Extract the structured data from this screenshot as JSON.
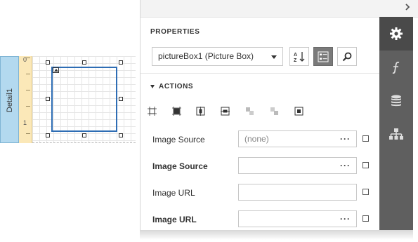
{
  "designer": {
    "band_label": "Detail1",
    "ruler_numbers": [
      "0",
      "1"
    ]
  },
  "panel": {
    "title": "PROPERTIES",
    "component_combo": "pictureBox1 (Picture Box)",
    "section_title": "ACTIONS",
    "rows": [
      {
        "label": "Image Source",
        "bold": false,
        "value": "(none)",
        "has_dots": true
      },
      {
        "label": "Image Source",
        "bold": true,
        "value": "",
        "has_dots": true
      },
      {
        "label": "Image URL",
        "bold": false,
        "value": "",
        "has_dots": false
      },
      {
        "label": "Image URL",
        "bold": true,
        "value": "",
        "has_dots": true
      }
    ],
    "dots": "···"
  },
  "tabs": [
    "gear-icon",
    "function-icon",
    "database-icon",
    "hierarchy-icon"
  ],
  "colors": {
    "accent": "#2e6db4",
    "tabbar": "#5f5f5f",
    "band": "#b3d9ef",
    "ruler": "#fbe8b8"
  }
}
